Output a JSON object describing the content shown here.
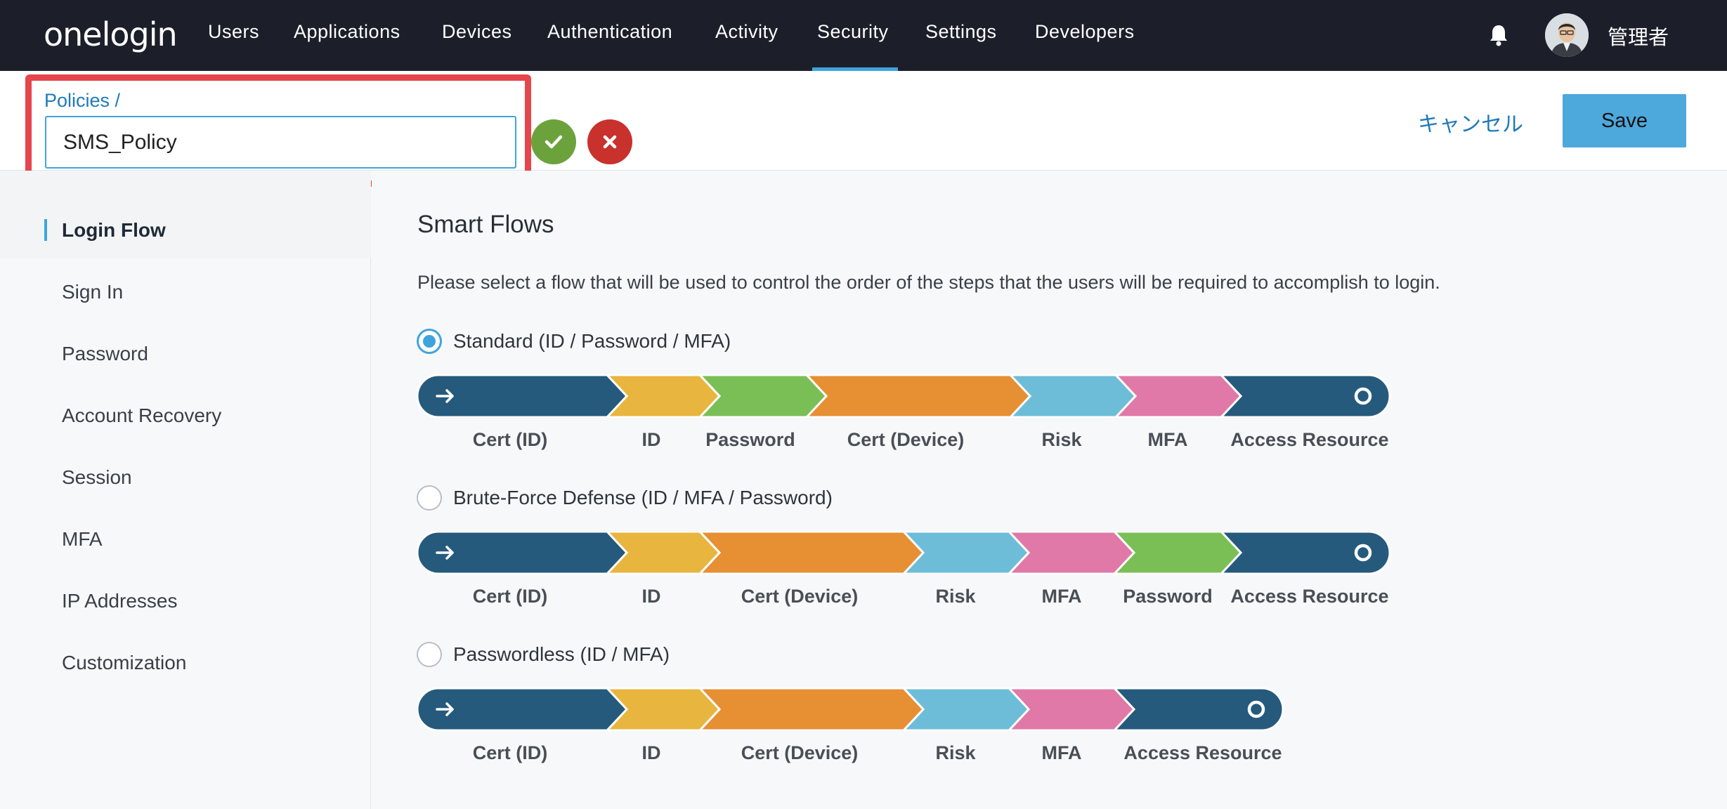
{
  "brand": {
    "logo_text": "onelogin"
  },
  "nav": {
    "items": [
      {
        "label": "Users"
      },
      {
        "label": "Applications"
      },
      {
        "label": "Devices"
      },
      {
        "label": "Authentication"
      },
      {
        "label": "Activity"
      },
      {
        "label": "Security"
      },
      {
        "label": "Settings"
      },
      {
        "label": "Developers"
      }
    ],
    "active": "Security",
    "accent_color": "#3fa4dd"
  },
  "user": {
    "name": "管理者",
    "bell_icon": "bell-icon"
  },
  "header": {
    "breadcrumb": "Policies /",
    "policy_name_value": "SMS_Policy",
    "cancel_label": "キャンセル",
    "save_label": "Save"
  },
  "sidebar": {
    "items": [
      {
        "label": "Login Flow",
        "active": true
      },
      {
        "label": "Sign In"
      },
      {
        "label": "Password"
      },
      {
        "label": "Account Recovery"
      },
      {
        "label": "Session"
      },
      {
        "label": "MFA"
      },
      {
        "label": "IP Addresses"
      },
      {
        "label": "Customization"
      }
    ]
  },
  "main": {
    "title": "Smart Flows",
    "description": "Please select a flow that will be used to control the order of the steps that the users will be required to accomplish to login.",
    "flows": [
      {
        "label": "Standard (ID / Password / MFA)",
        "selected": true,
        "steps": [
          "Cert (ID)",
          "ID",
          "Password",
          "Cert (Device)",
          "Risk",
          "MFA",
          "Access Resource"
        ]
      },
      {
        "label": "Brute-Force Defense (ID / MFA / Password)",
        "selected": false,
        "steps": [
          "Cert (ID)",
          "ID",
          "Cert (Device)",
          "Risk",
          "MFA",
          "Password",
          "Access Resource"
        ]
      },
      {
        "label": "Passwordless (ID / MFA)",
        "selected": false,
        "steps": [
          "Cert (ID)",
          "ID",
          "Cert (Device)",
          "Risk",
          "MFA",
          "Access Resource"
        ]
      }
    ],
    "step_colors": {
      "Cert (ID)": "#255a7c",
      "ID": "#e8b53f",
      "Password": "#7abf56",
      "Cert (Device)": "#e68f33",
      "Risk": "#6dbdd8",
      "MFA": "#e079a7",
      "Access Resource": "#255a7c"
    }
  }
}
